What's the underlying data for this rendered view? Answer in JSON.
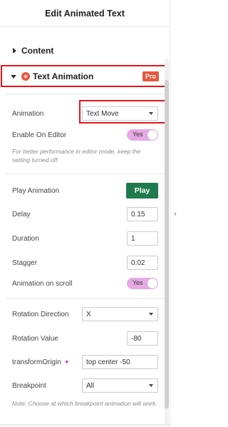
{
  "header": {
    "title": "Edit Animated Text"
  },
  "sections": {
    "content": {
      "label": "Content"
    },
    "text_animation": {
      "label": "Text Animation",
      "badge": "Pro",
      "icon": "animation-icon"
    }
  },
  "fields": {
    "animation": {
      "label": "Animation",
      "value": "Text Move"
    },
    "enable_on_editor": {
      "label": "Enable On Editor",
      "value": "Yes",
      "note": "For better performance in editor mode, keep the setting turned off."
    },
    "play_animation": {
      "label": "Play Animation",
      "button": "Play"
    },
    "delay": {
      "label": "Delay",
      "value": "0.15"
    },
    "duration": {
      "label": "Duration",
      "value": "1"
    },
    "stagger": {
      "label": "Stagger",
      "value": "0.02"
    },
    "animation_on_scroll": {
      "label": "Animation on scroll",
      "value": "Yes"
    },
    "rotation_direction": {
      "label": "Rotation Direction",
      "value": "X"
    },
    "rotation_value": {
      "label": "Rotation Value",
      "value": "-80"
    },
    "transform_origin": {
      "label": "transformOrigin",
      "value": "top center -50"
    },
    "breakpoint": {
      "label": "Breakpoint",
      "value": "All",
      "note": "Note: Choose at which breakpoint animation will work."
    }
  },
  "colors": {
    "accent_red": "#e2161e",
    "pro_orange": "#e9573f",
    "play_green": "#1f7a4f",
    "toggle_pink": "#e6a9e6"
  }
}
